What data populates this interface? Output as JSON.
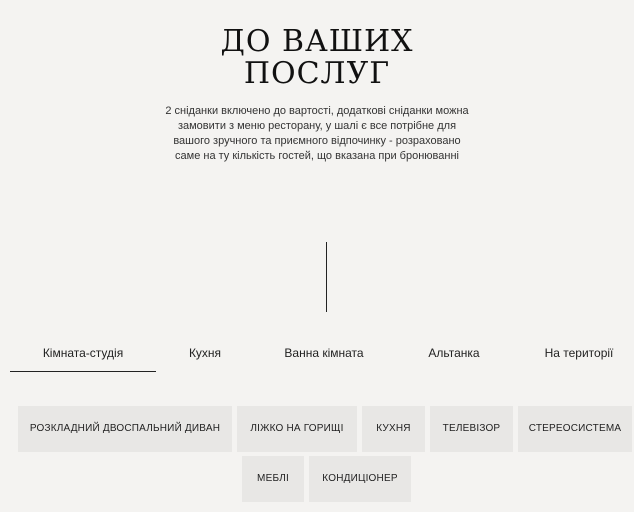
{
  "hero": {
    "title_line1": "ДО ВАШИХ",
    "title_line2": "ПОСЛУГ",
    "description": "2 сніданки включено до вартості, додаткові сніданки можна замовити з меню ресторану, у шалі є все потрібне для вашого зручного та приємного відпочинку - розраховано саме на ту кількість гостей, що вказана при бронюванні"
  },
  "tabs": [
    {
      "label": "Кімната-студія",
      "active": true
    },
    {
      "label": "Кухня",
      "active": false
    },
    {
      "label": "Ванна кімната",
      "active": false
    },
    {
      "label": "Альтанка",
      "active": false
    },
    {
      "label": "На території",
      "active": false
    }
  ],
  "amenities": [
    "РОЗКЛАДНИЙ ДВОСПАЛЬНИЙ ДИВАН",
    "ЛІЖКО НА ГОРИЩІ",
    "КУХНЯ",
    "ТЕЛЕВІЗОР",
    "СТЕРЕОСИСТЕМА",
    "МЕБЛІ",
    "КОНДИЦІОНЕР"
  ]
}
